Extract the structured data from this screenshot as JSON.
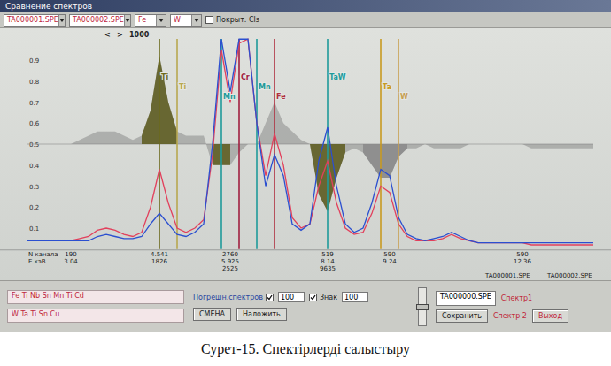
{
  "window": {
    "title": "Сравнение спектров"
  },
  "toolbar": {
    "combos": [
      {
        "value": "TA000001.SPE"
      },
      {
        "value": "TA000002.SPE"
      },
      {
        "value": "Fe"
      },
      {
        "value": "W"
      }
    ],
    "checkbox": {
      "label": "Покрыт. Cls",
      "checked": false
    }
  },
  "chart": {
    "top_labels": [
      "<",
      ">",
      "1000"
    ],
    "y_ticks": [
      "0.1",
      "0.2",
      "0.3",
      "0.4",
      "0.5",
      "0.6",
      "0.7",
      "0.8",
      "0.9"
    ],
    "series": [
      {
        "name": "TA000001.SPE",
        "color": "#e2405c",
        "values": [
          0.04,
          0.04,
          0.04,
          0.04,
          0.04,
          0.04,
          0.05,
          0.06,
          0.09,
          0.1,
          0.09,
          0.07,
          0.06,
          0.08,
          0.2,
          0.38,
          0.22,
          0.1,
          0.08,
          0.1,
          0.14,
          0.45,
          0.95,
          0.7,
          0.98,
          1.0,
          0.6,
          0.35,
          0.55,
          0.4,
          0.15,
          0.1,
          0.12,
          0.3,
          0.42,
          0.22,
          0.1,
          0.07,
          0.08,
          0.17,
          0.3,
          0.27,
          0.12,
          0.06,
          0.04,
          0.04,
          0.04,
          0.05,
          0.07,
          0.05,
          0.04,
          0.03,
          0.03,
          0.03,
          0.03,
          0.03,
          0.03,
          0.02,
          0.02,
          0.02,
          0.02,
          0.02,
          0.02,
          0.02,
          0.02
        ]
      },
      {
        "name": "TA000002.SPE",
        "color": "#2b4fd0",
        "values": [
          0.04,
          0.04,
          0.04,
          0.04,
          0.04,
          0.04,
          0.04,
          0.04,
          0.06,
          0.07,
          0.06,
          0.05,
          0.05,
          0.06,
          0.12,
          0.17,
          0.12,
          0.07,
          0.06,
          0.08,
          0.12,
          0.5,
          1.0,
          0.75,
          1.0,
          1.0,
          0.6,
          0.3,
          0.45,
          0.35,
          0.12,
          0.09,
          0.12,
          0.42,
          0.58,
          0.3,
          0.12,
          0.08,
          0.1,
          0.22,
          0.38,
          0.35,
          0.15,
          0.07,
          0.05,
          0.04,
          0.05,
          0.06,
          0.08,
          0.06,
          0.04,
          0.03,
          0.03,
          0.03,
          0.03,
          0.03,
          0.03,
          0.03,
          0.03,
          0.03,
          0.03,
          0.03,
          0.03,
          0.03,
          0.03
        ]
      }
    ],
    "windows": [
      {
        "from": 13,
        "to": 17,
        "color": "#5c5a1c"
      },
      {
        "from": 21,
        "to": 23,
        "color": "#5c5a1c"
      },
      {
        "from": 32,
        "to": 36,
        "color": "#5c5a1c"
      },
      {
        "from": 38,
        "to": 43,
        "color": "#8a8a8a"
      }
    ],
    "markers": [
      {
        "label": "Ti",
        "at": 15,
        "color": "#6b6a1e"
      },
      {
        "label": "Ti",
        "at": 17,
        "color": "#b8a850"
      },
      {
        "label": "Mn",
        "at": 22,
        "color": "#1f9a9a"
      },
      {
        "label": "Cr",
        "at": 24,
        "color": "#a02040"
      },
      {
        "label": "Mn",
        "at": 26,
        "color": "#1f9a9a"
      },
      {
        "label": "Fe",
        "at": 28,
        "color": "#b03040"
      },
      {
        "label": "TaW",
        "at": 34,
        "color": "#1f9a9a"
      },
      {
        "label": "Ta",
        "at": 40,
        "color": "#c89a20"
      },
      {
        "label": "W",
        "at": 42,
        "color": "#c8a050"
      }
    ],
    "row_labels": [
      "N канала",
      "E кэВ"
    ],
    "readouts": [
      {
        "at": 5,
        "lines": [
          "190",
          "3.04"
        ]
      },
      {
        "at": 15,
        "lines": [
          "4.541",
          "1826"
        ]
      },
      {
        "at": 23,
        "lines": [
          "2760",
          "5.925",
          "2525"
        ]
      },
      {
        "at": 34,
        "lines": [
          "519",
          "8.14",
          "9635"
        ]
      },
      {
        "at": 41,
        "lines": [
          "590",
          "9.24"
        ]
      },
      {
        "at": 56,
        "lines": [
          "590",
          "12.36"
        ]
      }
    ]
  },
  "controls": {
    "element_fields": [
      {
        "value": "Fe Ti Nb Sn Mn Ti Cd"
      },
      {
        "value": "W Ta Ti Sn Cu"
      }
    ],
    "accuracy": {
      "label": "Погрешн.спектров",
      "checked": true,
      "value": "100"
    },
    "sign": {
      "label": "Знак",
      "checked": true,
      "value": "100"
    },
    "buttons": [
      "СМЕНА",
      "Наложить"
    ],
    "slider": {
      "level": 0.5
    },
    "file_field": {
      "value": "TA000000.SPE"
    },
    "spectrum_labels": [
      "Спектр1",
      "Спектр 2"
    ],
    "save_button": "Сохранить",
    "exit_button": "Выход"
  },
  "caption": "Сурет-15. Спектірлерді салыстыру"
}
